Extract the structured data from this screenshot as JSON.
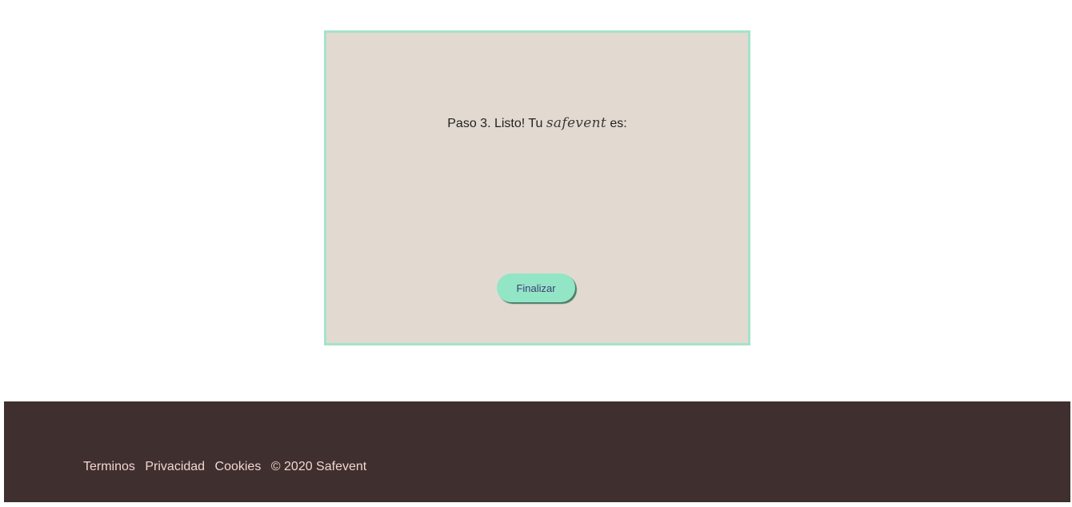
{
  "card": {
    "step_text": "Paso 3. Listo! Tu",
    "brand_word": "safevent",
    "step_suffix": "es:",
    "finish_label": "Finalizar"
  },
  "footer": {
    "links": [
      "Terminos",
      "Privacidad",
      "Cookies"
    ],
    "copyright": "© 2020 Safevent"
  },
  "colors": {
    "card_bg": "#e2dad0",
    "card_border": "#a3e4c9",
    "button_bg": "#93e6c5",
    "button_text": "#3c3b7a",
    "footer_bg": "#3f2f2e",
    "footer_text": "#f2d6d2"
  }
}
